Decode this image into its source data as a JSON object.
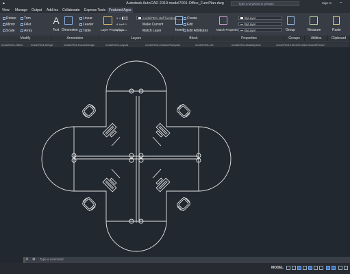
{
  "window": {
    "title": "Autodesk AutoCAD 2019    model7001-Office_FurnPlan.dwg",
    "search_placeholder": "Type a keyword or phrase",
    "sign_in": "Sign In"
  },
  "menu": [
    "View",
    "Manage",
    "Output",
    "Add-ins",
    "Collaborate",
    "Express Tools",
    "Featured Apps"
  ],
  "ribbon": {
    "modify": [
      "Rotate",
      "Trim",
      "Mirror",
      "Fillet",
      "Scale",
      "Array"
    ],
    "annotation": [
      "Text",
      "Dimension",
      "Linear",
      "Leader",
      "Table"
    ],
    "layers": [
      "Layer Properties",
      "Make Current",
      "Match Layer"
    ],
    "block": [
      "Insert",
      "Create",
      "Edit",
      "Edit Attributes"
    ],
    "properties": [
      "Match Properties",
      "ByLayer",
      "ByLayer",
      "ByLayer"
    ],
    "groups": "Group",
    "utilities": "Measure",
    "clipboard": "Paste",
    "layer_combo": "model7001 staff furniture"
  },
  "panels": [
    "Modify",
    "Annotation",
    "Layers",
    "Block",
    "Properties",
    "Groups",
    "Utilities",
    "Clipboard"
  ],
  "file_tabs": [
    "model7001-Office",
    "model7001-Merge",
    "model7001-HouseDesign",
    "model7001-Layout",
    "model7001-KitchenFloorplan",
    "model7001-Lift",
    "model7001-Masterpiece",
    "model7001-HomeFurnitureDuoOfPower*"
  ],
  "command": {
    "placeholder": "Type a command"
  },
  "status": {
    "model": "MODEL"
  }
}
